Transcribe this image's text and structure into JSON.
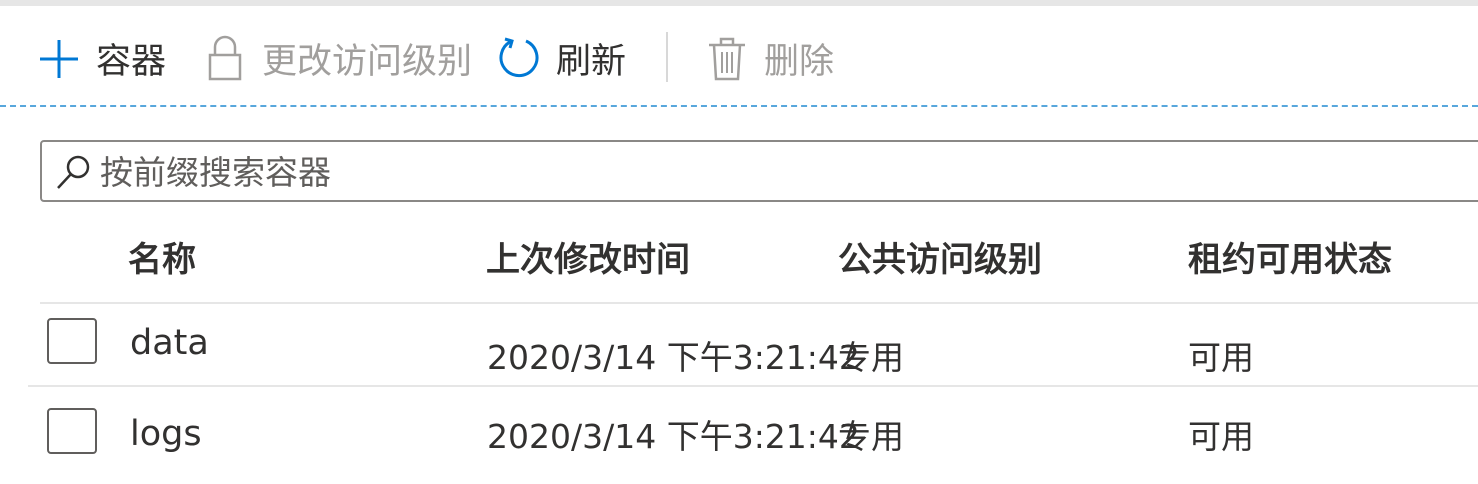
{
  "toolbar": {
    "add_container": {
      "label": "容器",
      "icon": "plus-icon",
      "enabled": true
    },
    "change_access": {
      "label": "更改访问级别",
      "icon": "lock-icon",
      "enabled": false
    },
    "refresh": {
      "label": "刷新",
      "icon": "refresh-icon",
      "enabled": true
    },
    "delete": {
      "label": "删除",
      "icon": "trash-icon",
      "enabled": false
    }
  },
  "search": {
    "placeholder": "按前缀搜索容器",
    "value": "",
    "icon": "search-icon"
  },
  "table": {
    "columns": [
      "名称",
      "上次修改时间",
      "公共访问级别",
      "租约可用状态"
    ],
    "rows": [
      {
        "name": "data",
        "modified": "2020/3/14 下午3:21:42",
        "access": "专用",
        "lease": "可用",
        "selected": false
      },
      {
        "name": "logs",
        "modified": "2020/3/14 下午3:21:42",
        "access": "专用",
        "lease": "可用",
        "selected": false
      }
    ]
  },
  "colors": {
    "accent": "#0078d4",
    "text": "#323130",
    "disabled": "#a19f9d",
    "divider": "#e6e6e6",
    "dashed_line": "#58a7dc"
  }
}
